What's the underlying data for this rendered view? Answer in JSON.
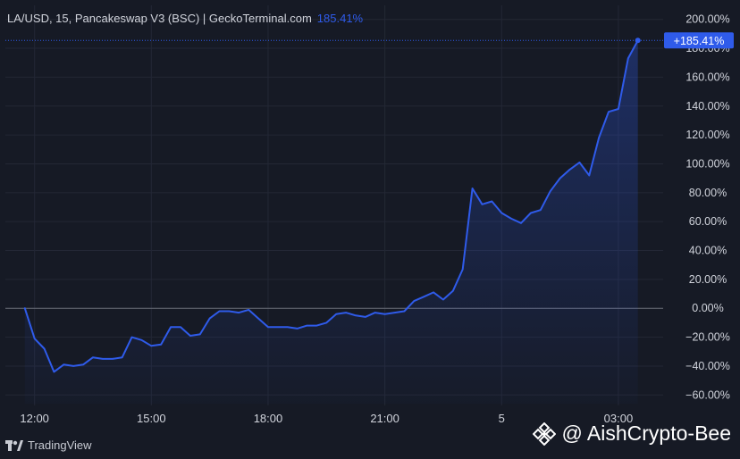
{
  "header": {
    "title": "LA/USD, 15, Pancakeswap V3 (BSC) | GeckoTerminal.com",
    "change": "185.41%"
  },
  "footer": {
    "brand": "TradingView",
    "watermark": "@ AishCrypto-Bee"
  },
  "colors": {
    "background": "#161a25",
    "line": "#2f5bea",
    "zero_line": "#6b6f7a",
    "grid": "#232735",
    "axis_text": "#d1d4dc",
    "badge": "#2f5bea"
  },
  "chart_data": {
    "type": "area",
    "series": [
      {
        "x": [
          0,
          0.25,
          0.5,
          0.75,
          1,
          1.25,
          1.5,
          1.75,
          2,
          2.25,
          2.5,
          2.75,
          3,
          3.25,
          3.5,
          3.75,
          4,
          4.25,
          4.5,
          4.75,
          5,
          5.25,
          5.5,
          5.75,
          6,
          6.25,
          6.5,
          6.75,
          7,
          7.25,
          7.5,
          7.75,
          8,
          8.25,
          8.5,
          8.75,
          9,
          9.25,
          9.5,
          9.75,
          10,
          10.25,
          10.5,
          10.75,
          11,
          11.25,
          11.5,
          11.75,
          12,
          12.25,
          12.5,
          12.75,
          13,
          13.25,
          13.5,
          13.75,
          14,
          14.25,
          14.5,
          14.75,
          15,
          15.25,
          15.5,
          15.75
        ],
        "values": [
          0,
          -21,
          -28,
          -44,
          -39,
          -40,
          -39,
          -34,
          -35,
          -35,
          -34,
          -20,
          -22,
          -26,
          -25,
          -13,
          -13,
          -19,
          -18,
          -7,
          -2,
          -2,
          -3,
          -1,
          -7,
          -13,
          -13,
          -13,
          -14,
          -12,
          -12,
          -10,
          -4,
          -3,
          -5,
          -6,
          -3,
          -4,
          -3,
          -2,
          5,
          8,
          11,
          6,
          12,
          27,
          83,
          72,
          74,
          66,
          62,
          59,
          66,
          68,
          81,
          90,
          96,
          101,
          92,
          118,
          136,
          138,
          173,
          185.41
        ]
      }
    ],
    "xlim": [
      -0.5,
      16.4
    ],
    "ylim": [
      -66,
      206
    ],
    "x_ticks": [
      {
        "x": 0.25,
        "label": "12:00"
      },
      {
        "x": 3.25,
        "label": "15:00"
      },
      {
        "x": 6.25,
        "label": "18:00"
      },
      {
        "x": 9.25,
        "label": "21:00"
      },
      {
        "x": 12.25,
        "label": "5"
      },
      {
        "x": 15.25,
        "label": "03:00"
      }
    ],
    "y_ticks": [
      {
        "y": 200,
        "label": "200.00%"
      },
      {
        "y": 180,
        "label": "180.00%"
      },
      {
        "y": 160,
        "label": "160.00%"
      },
      {
        "y": 140,
        "label": "140.00%"
      },
      {
        "y": 120,
        "label": "120.00%"
      },
      {
        "y": 100,
        "label": "100.00%"
      },
      {
        "y": 80,
        "label": "80.00%"
      },
      {
        "y": 60,
        "label": "60.00%"
      },
      {
        "y": 40,
        "label": "40.00%"
      },
      {
        "y": 20,
        "label": "20.00%"
      },
      {
        "y": 0,
        "label": "0.00%"
      },
      {
        "y": -20,
        "label": "−20.00%"
      },
      {
        "y": -40,
        "label": "−40.00%"
      },
      {
        "y": -60,
        "label": "−60.00%"
      }
    ],
    "last_value_label": "+185.41%",
    "grid": true
  }
}
